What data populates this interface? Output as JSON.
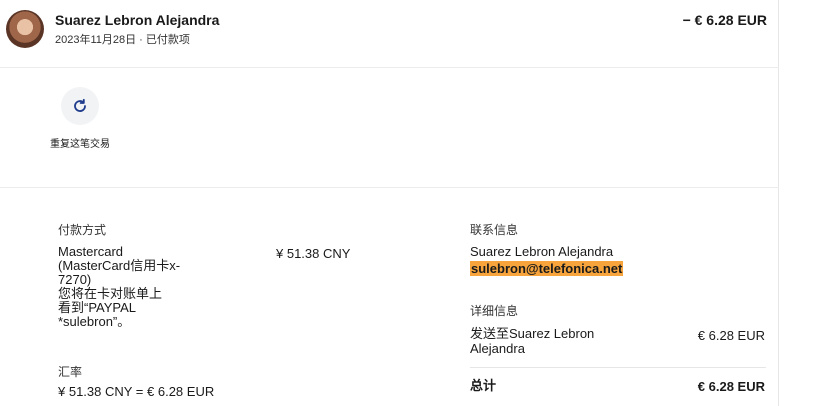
{
  "transaction": {
    "name": "Suarez Lebron Alejandra",
    "date_status": "2023年11月28日 · 已付款项",
    "amount": "− € 6.28 EUR"
  },
  "repeat": {
    "label": "重复这笔交易",
    "icon": "refresh-icon"
  },
  "payment": {
    "section_label": "付款方式",
    "card_line1": "Mastercard",
    "card_line2": "(MasterCard信用卡x-",
    "card_line3": "7270)",
    "statement_line1": "您将在卡对账单上",
    "statement_line2": "看到“PAYPAL",
    "statement_line3": "*sulebron”。",
    "amount_cny": "¥ 51.38 CNY"
  },
  "exchange": {
    "label": "汇率",
    "value": "¥ 51.38 CNY = € 6.28 EUR"
  },
  "contact": {
    "label": "联系信息",
    "name": "Suarez Lebron Alejandra",
    "email": "sulebron@telefonica.net"
  },
  "details": {
    "label": "详细信息",
    "sent_to_line1": "发送至Suarez Lebron",
    "sent_to_line2": "Alejandra",
    "sent_amount": "€ 6.28 EUR",
    "total_label": "总计",
    "total_amount": "€ 6.28 EUR"
  },
  "colors": {
    "highlight": "#f6a43b",
    "icon_blue": "#1f3b8c"
  }
}
